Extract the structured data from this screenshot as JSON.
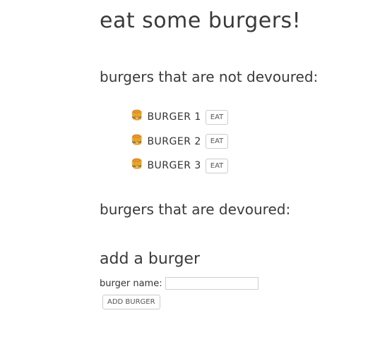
{
  "header": {
    "title": "eat some burgers!"
  },
  "not_devoured": {
    "heading": "burgers that are not devoured:",
    "burgers": [
      {
        "emoji": "🍔",
        "name": "BURGER 1",
        "button": "EAT"
      },
      {
        "emoji": "🍔",
        "name": "BURGER 2",
        "button": "EAT"
      },
      {
        "emoji": "🍔",
        "name": "BURGER 3",
        "button": "EAT"
      }
    ]
  },
  "devoured": {
    "heading": "burgers that are devoured:"
  },
  "add_form": {
    "heading": "add a burger",
    "label": "burger name:",
    "input_value": "",
    "button": "ADD BURGER"
  }
}
